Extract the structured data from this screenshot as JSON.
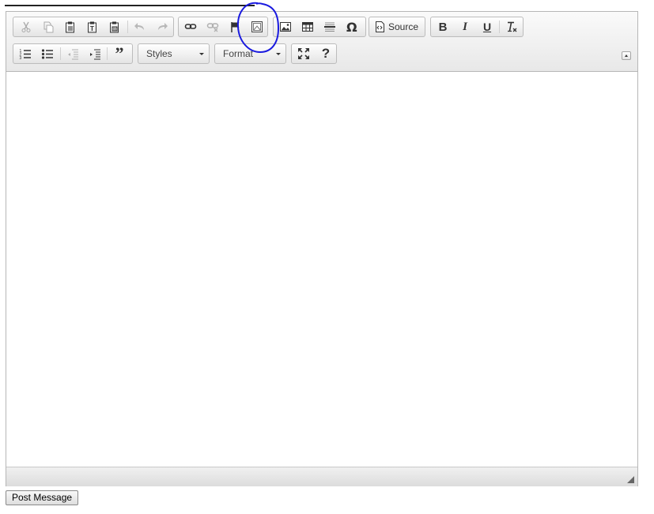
{
  "toolbar": {
    "row1": {
      "clipboard": [
        "cut-icon",
        "copy-icon",
        "paste-icon",
        "paste-text-icon",
        "paste-word-icon"
      ],
      "history": [
        "undo-icon",
        "redo-icon"
      ],
      "links": [
        "link-icon",
        "unlink-icon",
        "anchor-icon",
        "iframe-icon"
      ],
      "insert": [
        "image-icon",
        "table-icon",
        "horizontal-line-icon",
        "special-char-icon"
      ],
      "source_label": "Source",
      "basicstyles": [
        "bold-icon",
        "italic-icon",
        "underline-icon",
        "remove-format-icon"
      ]
    },
    "row2": {
      "lists": [
        "numbered-list-icon",
        "bulleted-list-icon"
      ],
      "indent": [
        "outdent-icon",
        "indent-icon",
        "blockquote-icon"
      ],
      "styles_label": "Styles",
      "format_label": "Format",
      "tools": [
        "maximize-icon",
        "help-icon"
      ]
    }
  },
  "editor": {
    "content": ""
  },
  "annotation": {
    "color": "#1a1adf",
    "target": "iframe-icon"
  },
  "post_button_label": "Post Message"
}
